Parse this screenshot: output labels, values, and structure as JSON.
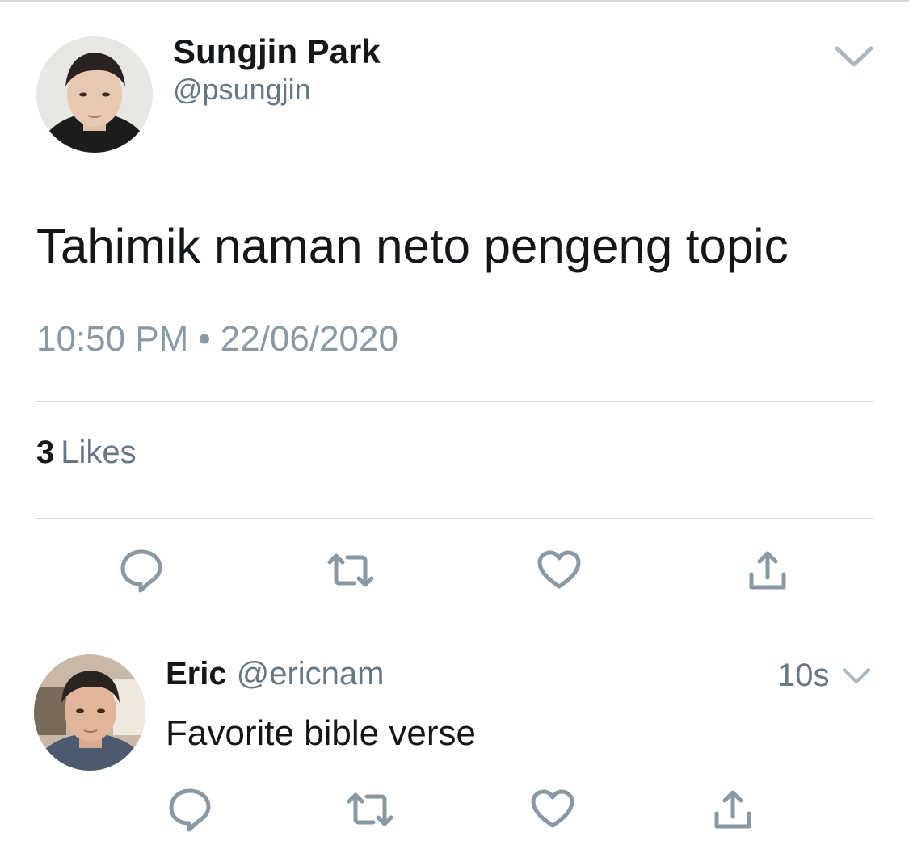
{
  "main_tweet": {
    "display_name": "Sungjin Park",
    "handle": "@psungjin",
    "text": "Tahimik naman neto pengeng topic",
    "time": "10:50 PM",
    "separator": "•",
    "date": "22/06/2020",
    "likes_count": "3",
    "likes_label": "Likes",
    "actions": [
      "reply-icon",
      "retweet-icon",
      "like-icon",
      "share-icon"
    ]
  },
  "reply_tweet": {
    "display_name": "Eric",
    "handle": "@ericnam",
    "time": "10s",
    "text": "Favorite bible verse",
    "actions": [
      "reply-icon",
      "retweet-icon",
      "like-icon",
      "share-icon"
    ]
  },
  "colors": {
    "text_primary": "#14171a",
    "text_secondary": "#657786",
    "icon_gray": "#8899a6",
    "divider": "#ccd6dd"
  }
}
